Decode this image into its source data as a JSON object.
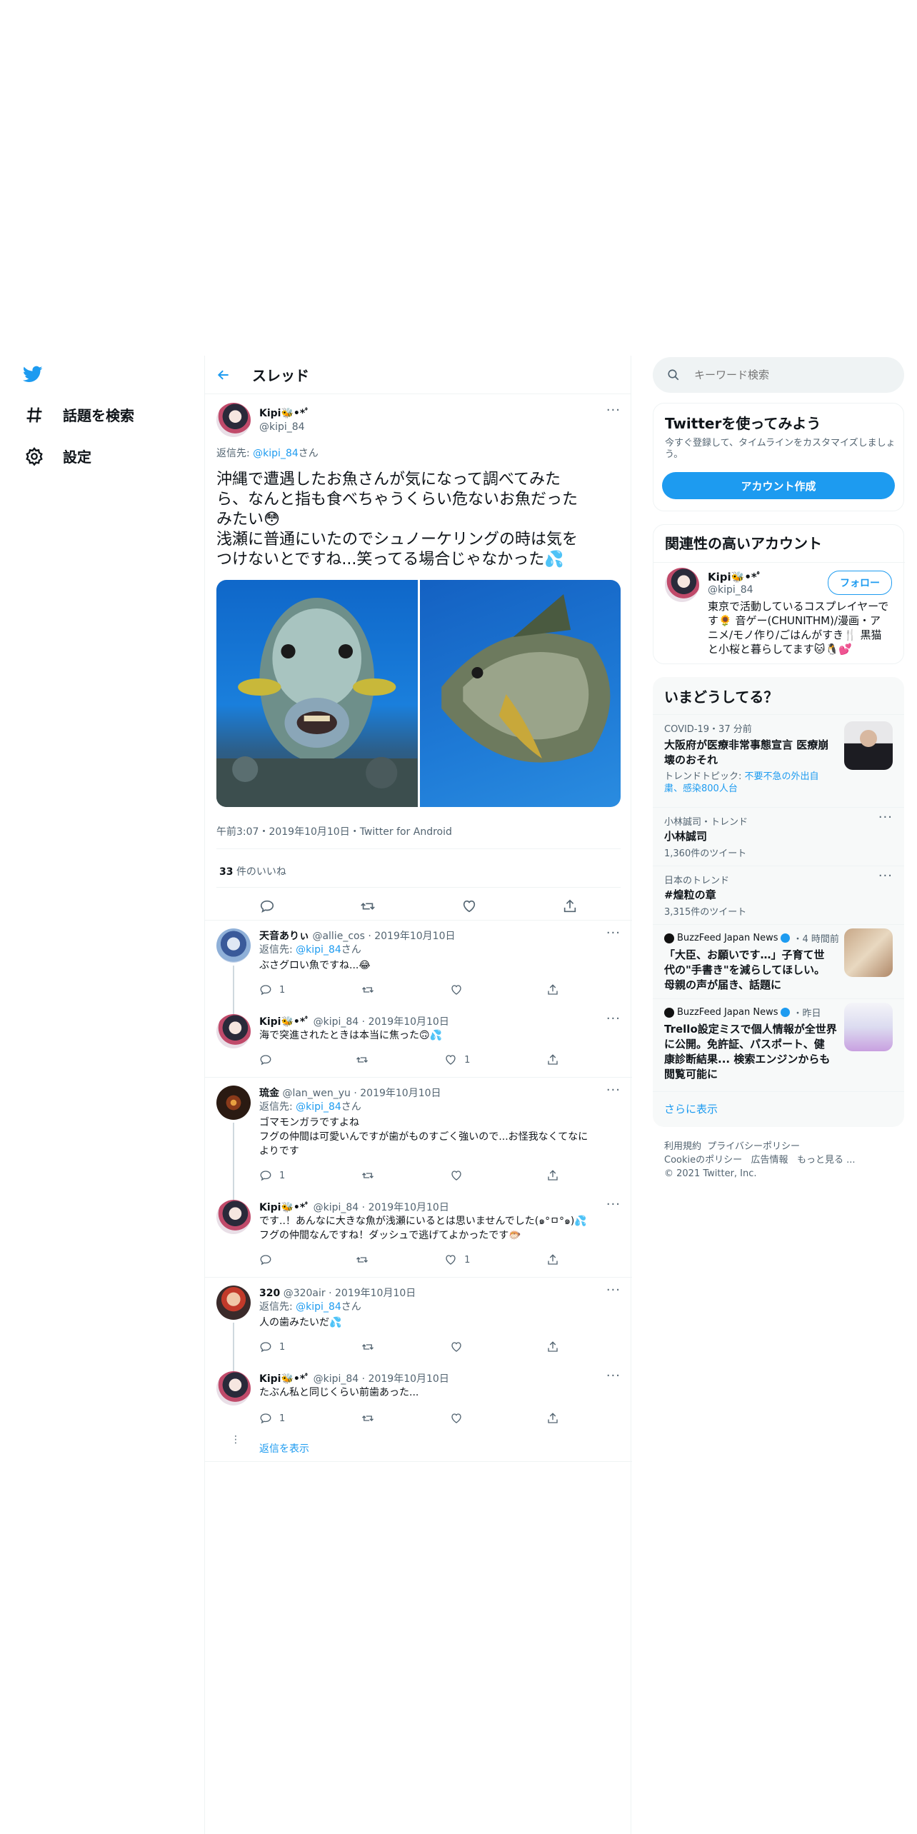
{
  "nav": {
    "explore": "話題を検索",
    "settings": "設定"
  },
  "header": {
    "title": "スレッド"
  },
  "main_tweet": {
    "name": "Kipi🐝•*ﾟ",
    "handle": "@kipi_84",
    "reply_label": "返信先: ",
    "reply_handle": "@kipi_84",
    "reply_suffix": "さん",
    "text_line1": "沖縄で遭遇したお魚さんが気になって調べてみた",
    "text_line2": "ら、なんと指も食べちゃうくらい危ないお魚だった",
    "text_line3": "みたい😳",
    "text_line4": "浅瀬に普通にいたのでシュノーケリングの時は気を",
    "text_line5": "つけないとですね...笑ってる場合じゃなかった💦",
    "meta": "午前3:07・2019年10月10日・Twitter for Android",
    "likes_count": "33",
    "likes_label": "件のいいね"
  },
  "replies": [
    {
      "name": "天音ありぃ",
      "handle": "@allie_cos",
      "date": "2019年10月10日",
      "reply_to": "@kipi_84",
      "reply_suffix": "さん",
      "line1": "ぶさグロい魚ですね...😂",
      "line2": "",
      "reply_count": "1",
      "like_count": ""
    },
    {
      "name": "Kipi🐝•*ﾟ",
      "handle": "@kipi_84",
      "date": "2019年10月10日",
      "reply_to": "",
      "reply_suffix": "",
      "line1": "海で突進されたときは本当に焦った🙃💦",
      "line2": "",
      "reply_count": "",
      "like_count": "1"
    },
    {
      "name": "琉金",
      "handle": "@lan_wen_yu",
      "date": "2019年10月10日",
      "reply_to": "@kipi_84",
      "reply_suffix": "さん",
      "line1": "ゴマモンガラですよね",
      "line2": "フグの仲間は可愛いんですが歯がものすごく強いので...お怪我なくてなに",
      "line3": "よりです",
      "reply_count": "1",
      "like_count": ""
    },
    {
      "name": "Kipi🐝•*ﾟ",
      "handle": "@kipi_84",
      "date": "2019年10月10日",
      "reply_to": "",
      "reply_suffix": "",
      "line1": "です..！あんなに大きな魚が浅瀬にいるとは思いませんでした(๑°ㅁ°๑)💦",
      "line2": "フグの仲間なんですね！ダッシュで逃げてよかったです🐡",
      "reply_count": "",
      "like_count": "1"
    },
    {
      "name": "320",
      "handle": "@320air",
      "date": "2019年10月10日",
      "reply_to": "@kipi_84",
      "reply_suffix": "さん",
      "line1": "人の歯みたいだ💦",
      "line2": "",
      "reply_count": "1",
      "like_count": ""
    },
    {
      "name": "Kipi🐝•*ﾟ",
      "handle": "@kipi_84",
      "date": "2019年10月10日",
      "reply_to": "",
      "reply_suffix": "",
      "line1": "たぶん私と同じくらい前歯あった...",
      "line2": "",
      "reply_count": "1",
      "like_count": ""
    }
  ],
  "show_replies": "返信を表示",
  "search": {
    "placeholder": "キーワード検索"
  },
  "signup": {
    "title": "Twitterを使ってみよう",
    "desc_line1": "今すぐ登録して、タイムラインをカスタマイズしましょ",
    "desc_line2": "う。",
    "button": "アカウント作成"
  },
  "related": {
    "title": "関連性の高いアカウント",
    "name": "Kipi🐝•*ﾟ",
    "handle": "@kipi_84",
    "follow": "フォロー",
    "bio1": "東京で活動しているコスプレイヤーで",
    "bio2": "す🌻 音ゲー(CHUNITHM)/漫画・ア",
    "bio3": "ニメ/モノ作り/ごはんがすき🍴 黒猫",
    "bio4": "と小桜と暮らしてます🐱🐧💕"
  },
  "trends": {
    "title": "いまどうしてる？",
    "items": [
      {
        "meta": "COVID-19・37 分前",
        "title1": "大阪府が医療非常事態宣言 医療崩",
        "title2": "壊のおそれ",
        "sub_label": "トレンドトピック: ",
        "sub1": "不要不急の外出自",
        "sub2": "粛、感染800人台"
      },
      {
        "meta": "小林誠司・トレンド",
        "title1": "小林誠司",
        "count": "1,360件のツイート"
      },
      {
        "meta": "日本のトレンド",
        "title1": "#煌粒の章",
        "count": "3,315件のツイート"
      },
      {
        "meta_source": "BuzzFeed Japan News",
        "meta_time": "・4 時間前",
        "title1": "「大臣、お願いです…」子育て世",
        "title2": "代の\"手書き\"を減らしてほしい。",
        "title3": "母親の声が届き、話題に"
      },
      {
        "meta_source": "BuzzFeed Japan News",
        "meta_time": "・昨日",
        "title1": "Trello設定ミスで個人情報が全世界",
        "title2": "に公開。免許証、パスポート、健",
        "title3": "康診断結果... 検索エンジンからも",
        "title4": "閲覧可能に"
      }
    ],
    "more": "さらに表示"
  },
  "footer": {
    "terms": "利用規約",
    "privacy": "プライバシーポリシー",
    "cookie": "Cookieのポリシー",
    "ads": "広告情報",
    "more": "もっと見る ...",
    "copyright": "© 2021 Twitter, Inc."
  },
  "colors": {
    "accent": "#1d9bf0",
    "text": "#0f1419",
    "muted": "#536471"
  }
}
